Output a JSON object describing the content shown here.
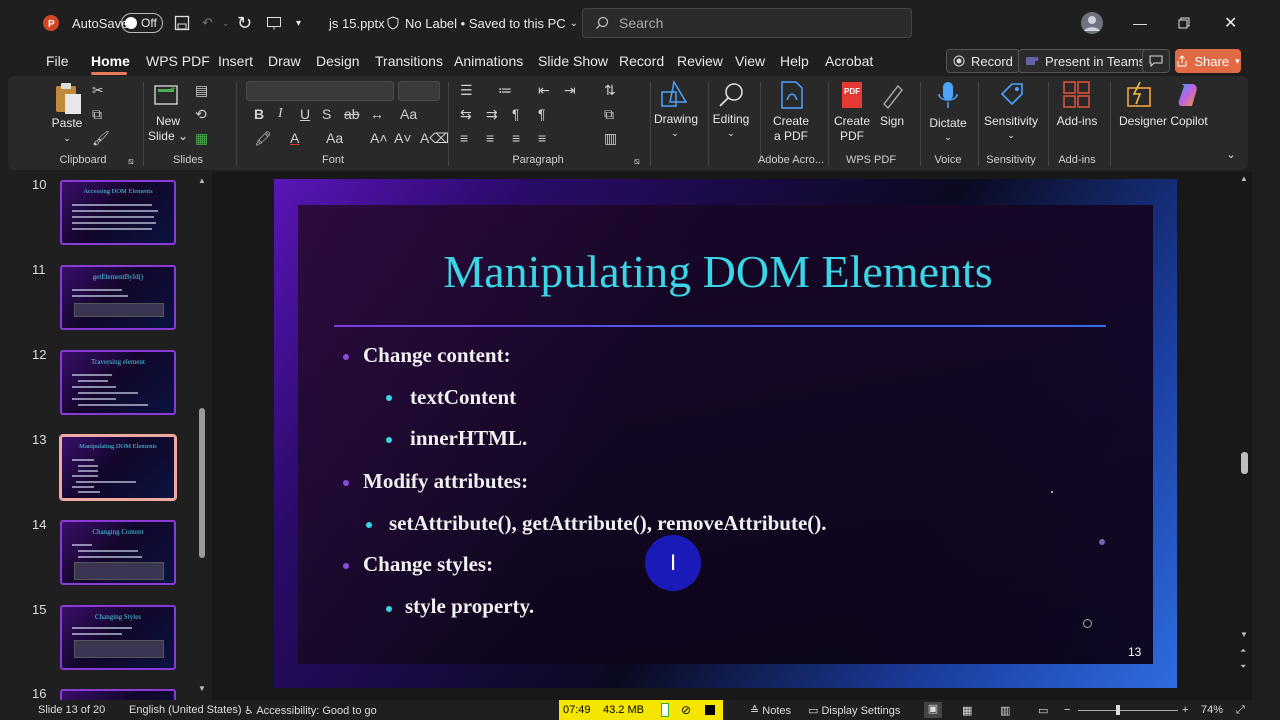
{
  "titlebar": {
    "autosave_label": "AutoSave",
    "autosave_state": "Off",
    "filename": "js 15.pptx",
    "label_status": "No Label • Saved to this PC",
    "search_placeholder": "Search"
  },
  "menu": {
    "tabs": [
      "File",
      "Home",
      "WPS PDF",
      "Insert",
      "Draw",
      "Design",
      "Transitions",
      "Animations",
      "Slide Show",
      "Record",
      "Review",
      "View",
      "Help",
      "Acrobat"
    ],
    "active": "Home",
    "record_button": "Record",
    "present_teams": "Present in Teams",
    "share": "Share"
  },
  "ribbon": {
    "paste": "Paste",
    "new_slide_1": "New",
    "new_slide_2": "Slide",
    "drawing": "Drawing",
    "editing": "Editing",
    "create_pdf_1": "Create",
    "create_pdf_2": "a PDF",
    "create_pdf_wps_1": "Create",
    "create_pdf_wps_2": "PDF",
    "sign": "Sign",
    "dictate": "Dictate",
    "sensitivity": "Sensitivity",
    "addins": "Add-ins",
    "designer": "Designer",
    "copilot": "Copilot",
    "groups": {
      "clipboard": "Clipboard",
      "slides": "Slides",
      "font": "Font",
      "paragraph": "Paragraph",
      "adobe": "Adobe Acro...",
      "wps": "WPS PDF",
      "voice": "Voice",
      "sensitivity": "Sensitivity",
      "addins": "Add-ins"
    }
  },
  "thumbnails": [
    {
      "num": "10",
      "title": "Accessing DOM Elements"
    },
    {
      "num": "11",
      "title": "getElementById()"
    },
    {
      "num": "12",
      "title": "Traversing element"
    },
    {
      "num": "13",
      "title": "Manipulating DOM Elements"
    },
    {
      "num": "14",
      "title": "Changing Content"
    },
    {
      "num": "15",
      "title": "Changing Styles"
    },
    {
      "num": "16",
      "title": ""
    }
  ],
  "slide": {
    "title": "Manipulating DOM Elements",
    "bullets": [
      {
        "text": "Change content:",
        "level": 1
      },
      {
        "text": "textContent",
        "level": 2
      },
      {
        "text": "innerHTML.",
        "level": 2
      },
      {
        "text": "Modify attributes:",
        "level": 1
      },
      {
        "text": "setAttribute(), getAttribute(), removeAttribute().",
        "level": 2
      },
      {
        "text": "Change styles:",
        "level": 1
      },
      {
        "text": "style property.",
        "level": 2
      }
    ],
    "number": "13"
  },
  "status": {
    "slide_of": "Slide 13 of 20",
    "language": "English (United States)",
    "accessibility": "Accessibility: Good to go",
    "time": "07:49",
    "memory": "43.2 MB",
    "notes": "Notes",
    "display_settings": "Display Settings",
    "zoom": "74%"
  },
  "colors": {
    "accent": "#e06a43",
    "title_cyan": "#3ad6e6",
    "bullet_purple": "#8a4ae0",
    "bullet_cyan": "#3ad6e6"
  }
}
